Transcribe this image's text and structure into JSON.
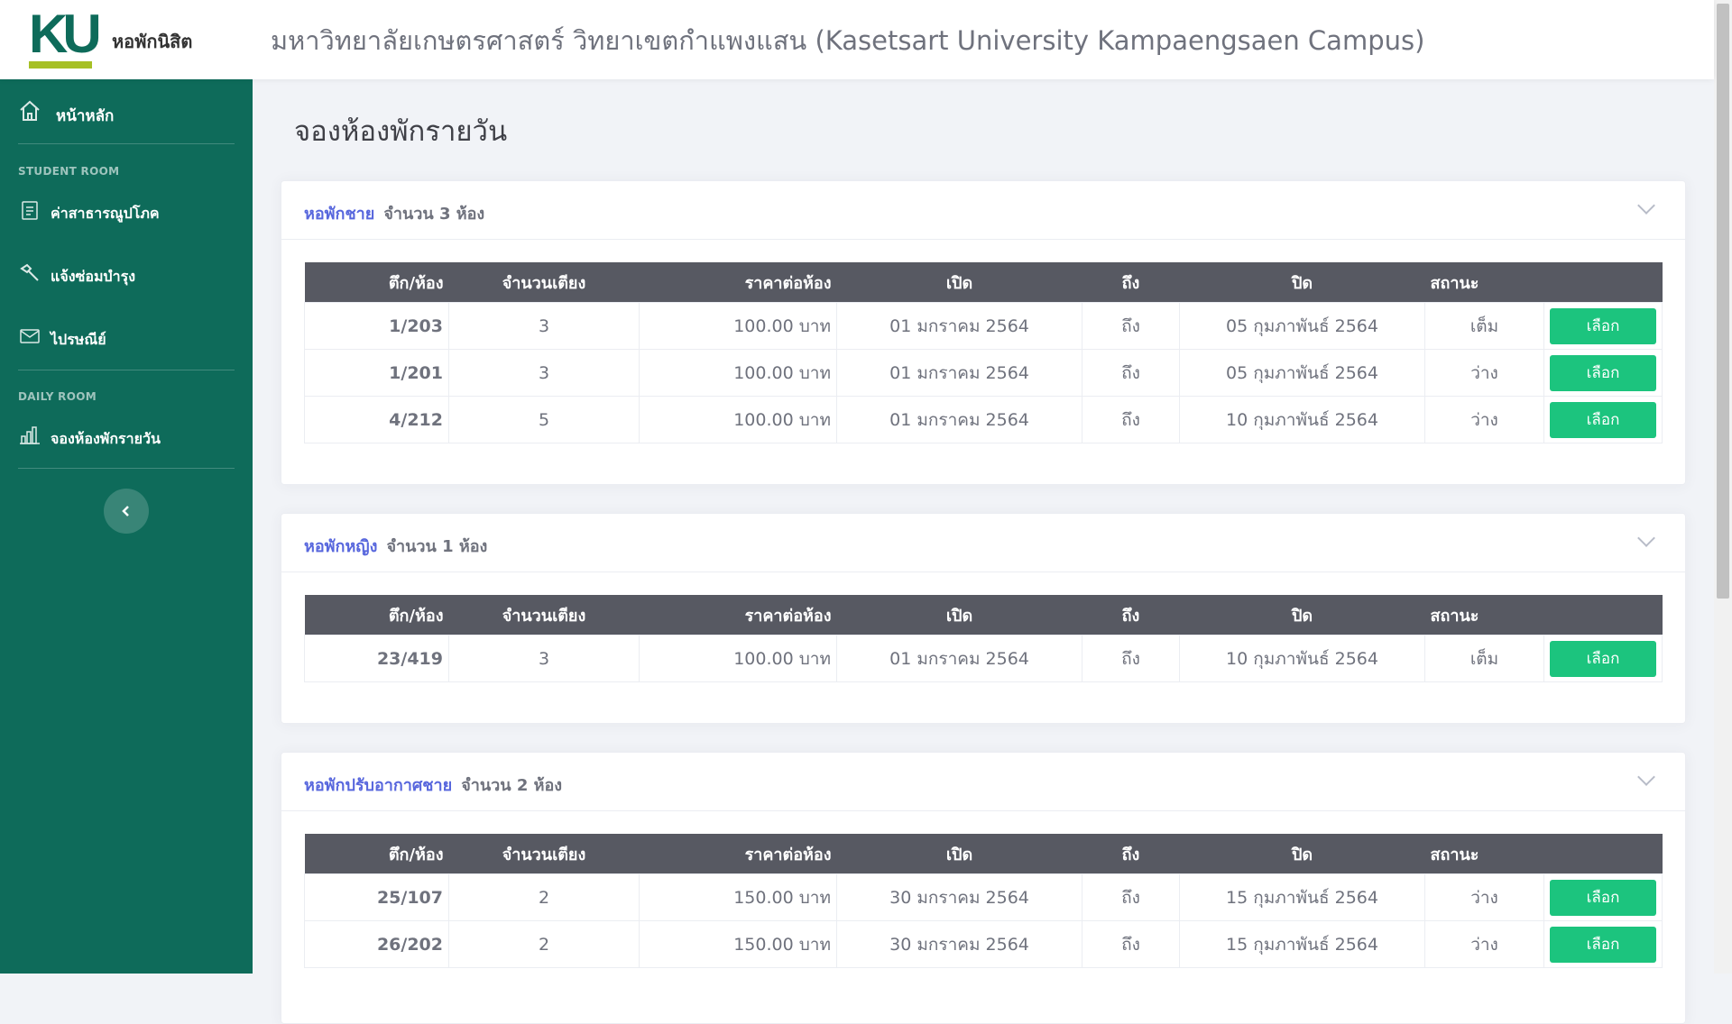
{
  "header": {
    "logo_mark": "KU",
    "logo_text": "หอพักนิสิต",
    "site_title": "มหาวิทยาลัยเกษตรศาสตร์ วิทยาเขตกำแพงแสน (Kasetsart University Kampaengsaen Campus)"
  },
  "sidebar": {
    "home_label": "หน้าหลัก",
    "section_student": "STUDENT ROOM",
    "item_utilities": "ค่าสาธารณูปโภค",
    "item_repair": "แจ้งซ่อมบำรุง",
    "item_mail": "ไปรษณีย์",
    "section_daily": "DAILY ROOM",
    "item_daily_booking": "จองห้องพักรายวัน",
    "collapse_icon": "chevron-left-icon"
  },
  "page": {
    "title": "จองห้องพักรายวัน"
  },
  "table_headers": {
    "room": "ตึก/ห้อง",
    "beds": "จำนวนเตียง",
    "price": "ราคาต่อห้อง",
    "open": "เปิด",
    "to": "ถึง",
    "close": "ปิด",
    "status": "สถานะ"
  },
  "dorms": [
    {
      "name": "หอพักชาย",
      "count": "จำนวน 3 ห้อง",
      "rooms": [
        {
          "room": "1/203",
          "beds": "3",
          "price": "100.00 บาท",
          "open": "01 มกราคม 2564",
          "to": "ถึง",
          "close": "05 กุมภาพันธ์ 2564",
          "status": "เต็ม",
          "action": "เลือก"
        },
        {
          "room": "1/201",
          "beds": "3",
          "price": "100.00 บาท",
          "open": "01 มกราคม 2564",
          "to": "ถึง",
          "close": "05 กุมภาพันธ์ 2564",
          "status": "ว่าง",
          "action": "เลือก"
        },
        {
          "room": "4/212",
          "beds": "5",
          "price": "100.00 บาท",
          "open": "01 มกราคม 2564",
          "to": "ถึง",
          "close": "10 กุมภาพันธ์ 2564",
          "status": "ว่าง",
          "action": "เลือก"
        }
      ]
    },
    {
      "name": "หอพักหญิง",
      "count": "จำนวน 1 ห้อง",
      "rooms": [
        {
          "room": "23/419",
          "beds": "3",
          "price": "100.00 บาท",
          "open": "01 มกราคม 2564",
          "to": "ถึง",
          "close": "10 กุมภาพันธ์ 2564",
          "status": "เต็ม",
          "action": "เลือก"
        }
      ]
    },
    {
      "name": "หอพักปรับอากาศชาย",
      "count": "จำนวน 2 ห้อง",
      "rooms": [
        {
          "room": "25/107",
          "beds": "2",
          "price": "150.00 บาท",
          "open": "30 มกราคม 2564",
          "to": "ถึง",
          "close": "15 กุมภาพันธ์ 2564",
          "status": "ว่าง",
          "action": "เลือก"
        },
        {
          "room": "26/202",
          "beds": "2",
          "price": "150.00 บาท",
          "open": "30 มกราคม 2564",
          "to": "ถึง",
          "close": "15 กุมภาพันธ์ 2564",
          "status": "ว่าง",
          "action": "เลือก"
        }
      ]
    }
  ],
  "colors": {
    "sidebar_bg": "#0e6b5a",
    "logo_accent": "#a6c025",
    "link_blue": "#5867dd",
    "status_full": "#f4516c",
    "status_free": "#34bfa3",
    "button_green": "#1cc47e",
    "table_header_bg": "#575962"
  }
}
